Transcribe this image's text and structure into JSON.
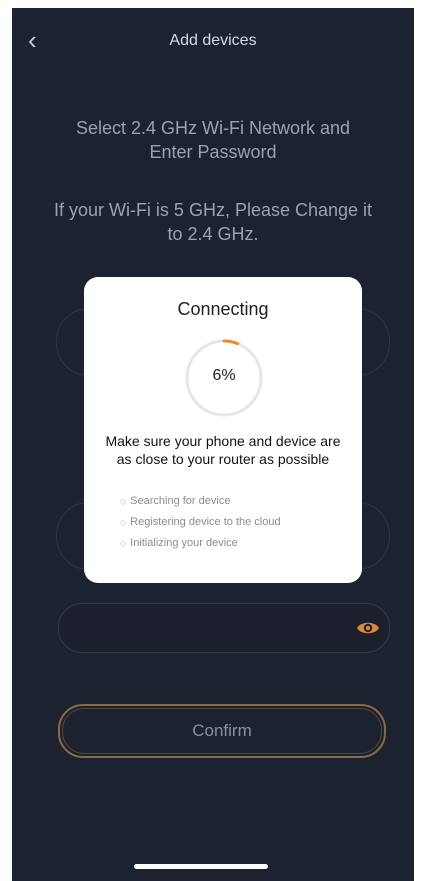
{
  "header": {
    "back_icon": "chevron-left-icon",
    "title": "Add devices"
  },
  "instructions": {
    "headline": "Select 2.4 GHz Wi-Fi Network and Enter Password",
    "subline": "If your Wi-Fi is 5 GHz, Please Change it to 2.4 GHz."
  },
  "form": {
    "password_value": "",
    "eye_icon": "eye-icon",
    "confirm_label": "Confirm"
  },
  "dialog": {
    "title": "Connecting",
    "progress_percent": 6,
    "progress_label": "6%",
    "message": "Make sure your phone and device are as close to your router as possible",
    "steps": [
      "Searching for device",
      "Registering device to the cloud",
      "Initializing your device"
    ]
  },
  "colors": {
    "background": "#1d2230",
    "accent": "#f08a2c",
    "dialog_bg": "#ffffff",
    "confirm_border": "#8a6a44"
  }
}
